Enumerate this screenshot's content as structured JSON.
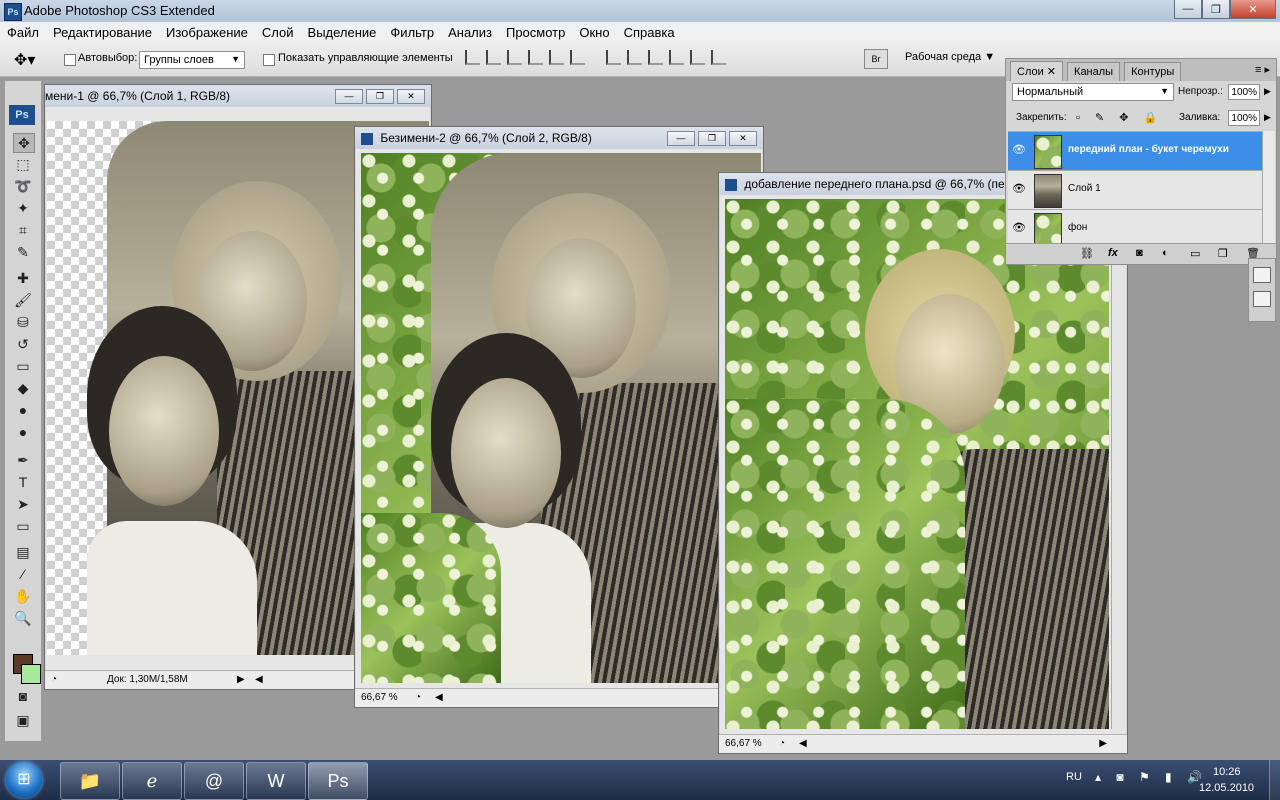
{
  "app": {
    "title": "Adobe Photoshop CS3 Extended",
    "icon_label": "Ps"
  },
  "window_controls": {
    "minimize": "—",
    "restore": "❐",
    "close": "✕"
  },
  "menu": [
    "Файл",
    "Редактирование",
    "Изображение",
    "Слой",
    "Выделение",
    "Фильтр",
    "Анализ",
    "Просмотр",
    "Окно",
    "Справка"
  ],
  "options": {
    "autoselect_label": "Автовыбор:",
    "autoselect_value": "Группы слоев",
    "show_controls_label": "Показать управляющие элементы",
    "workspace_label": "Рабочая среда",
    "bridge_label": "Br"
  },
  "toolbox": {
    "logo": "Ps"
  },
  "documents": [
    {
      "title": "мени-1 @ 66,7% (Слой 1, RGB/8)",
      "status": "Док: 1,30M/1,58M"
    },
    {
      "title": "Безимени-2 @ 66,7% (Слой 2, RGB/8)",
      "zoom": "66,67 %"
    },
    {
      "title": "добавление переднего плана.psd @ 66,7% (пер",
      "zoom": "66,67 %"
    }
  ],
  "layers_panel": {
    "tabs": [
      "Слои",
      "Каналы",
      "Контуры"
    ],
    "blend_mode": "Нормальный",
    "opacity_label": "Непрозр.:",
    "opacity_value": "100%",
    "lock_label": "Закрепить:",
    "fill_label": "Заливка:",
    "fill_value": "100%",
    "layers": [
      {
        "name": "передний план - букет черемухи",
        "active": true
      },
      {
        "name": "Слой 1",
        "active": false
      },
      {
        "name": "фон",
        "active": false
      }
    ],
    "footer_icons": [
      "link-icon",
      "fx-icon",
      "mask-icon",
      "adjustment-icon",
      "group-icon",
      "new-layer-icon",
      "trash-icon"
    ]
  },
  "taskbar": {
    "lang": "RU",
    "time": "10:26",
    "date": "12.05.2010",
    "apps": [
      "explorer-icon",
      "ie-icon",
      "mail-icon",
      "word-icon",
      "photoshop-icon"
    ]
  },
  "colors": {
    "foreground": "#5b3b25",
    "background": "#a8e89b",
    "layer_active": "#3d8ee8"
  }
}
